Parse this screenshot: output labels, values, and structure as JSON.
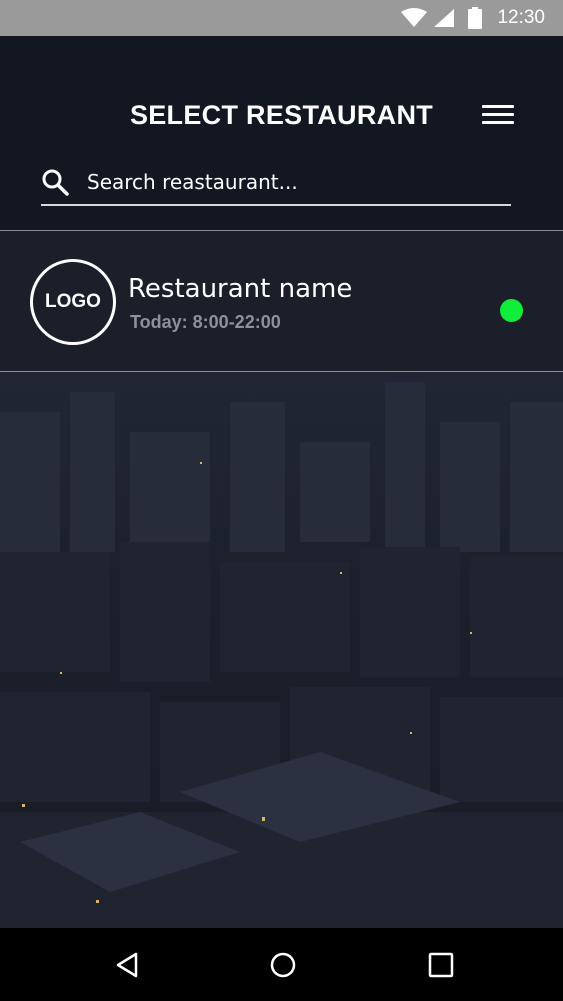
{
  "status_bar": {
    "time": "12:30",
    "icons": [
      "wifi-icon",
      "signal-icon",
      "battery-icon"
    ],
    "background": "#9a9a9a"
  },
  "header": {
    "title": "SELECT RESTAURANT",
    "menu_icon": "hamburger-menu-icon"
  },
  "search": {
    "placeholder": "Search reastaurant...",
    "value": "",
    "icon": "search-icon"
  },
  "restaurants": [
    {
      "logo_text": "LOGO",
      "name": "Restaurant name",
      "hours": "Today: 8:00-22:00",
      "status": "open",
      "status_color": "#11ee3a"
    }
  ],
  "nav_bar": {
    "buttons": [
      "back-icon",
      "home-icon",
      "recent-apps-icon"
    ]
  },
  "colors": {
    "header_bg": "#121722",
    "list_item_bg": "#1a1f2a",
    "hours_text": "#8d9199",
    "open_status": "#11ee3a"
  }
}
